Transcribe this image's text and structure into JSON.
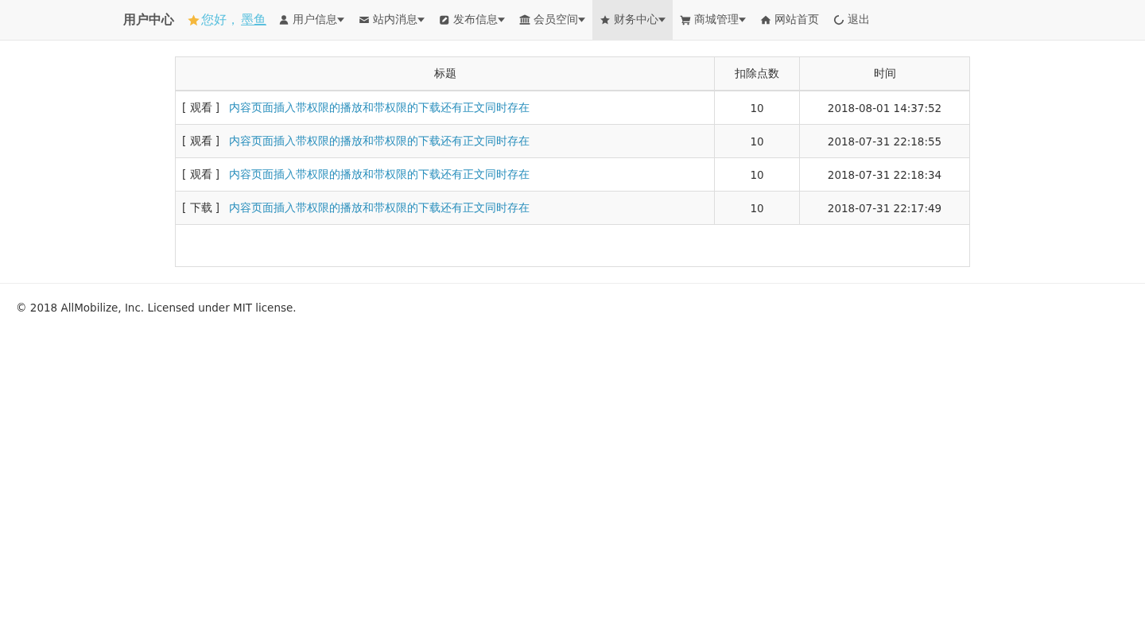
{
  "navbar": {
    "brand": "用户中心",
    "greeting": "您好，",
    "username": "墨鱼",
    "items": [
      {
        "label": "用户信息",
        "dropdown": true,
        "selected": false
      },
      {
        "label": "站内消息",
        "dropdown": true,
        "selected": false
      },
      {
        "label": "发布信息",
        "dropdown": true,
        "selected": false
      },
      {
        "label": "会员空间",
        "dropdown": true,
        "selected": false
      },
      {
        "label": "财务中心",
        "dropdown": true,
        "selected": true
      },
      {
        "label": "商城管理",
        "dropdown": true,
        "selected": false
      },
      {
        "label": "网站首页",
        "dropdown": false,
        "selected": false
      },
      {
        "label": "退出",
        "dropdown": false,
        "selected": false
      }
    ]
  },
  "table": {
    "columns": [
      "标题",
      "扣除点数",
      "时间"
    ],
    "rows": [
      {
        "action": "[ 观看 ]",
        "title": "内容页面插入带权限的播放和带权限的下载还有正文同时存在",
        "points": "10",
        "time": "2018-08-01 14:37:52"
      },
      {
        "action": "[ 观看 ]",
        "title": "内容页面插入带权限的播放和带权限的下载还有正文同时存在",
        "points": "10",
        "time": "2018-07-31 22:18:55"
      },
      {
        "action": "[ 观看 ]",
        "title": "内容页面插入带权限的播放和带权限的下载还有正文同时存在",
        "points": "10",
        "time": "2018-07-31 22:18:34"
      },
      {
        "action": "[ 下载 ]",
        "title": "内容页面插入带权限的播放和带权限的下载还有正文同时存在",
        "points": "10",
        "time": "2018-07-31 22:17:49"
      }
    ]
  },
  "footer": "© 2018 AllMobilize, Inc. Licensed under MIT license."
}
